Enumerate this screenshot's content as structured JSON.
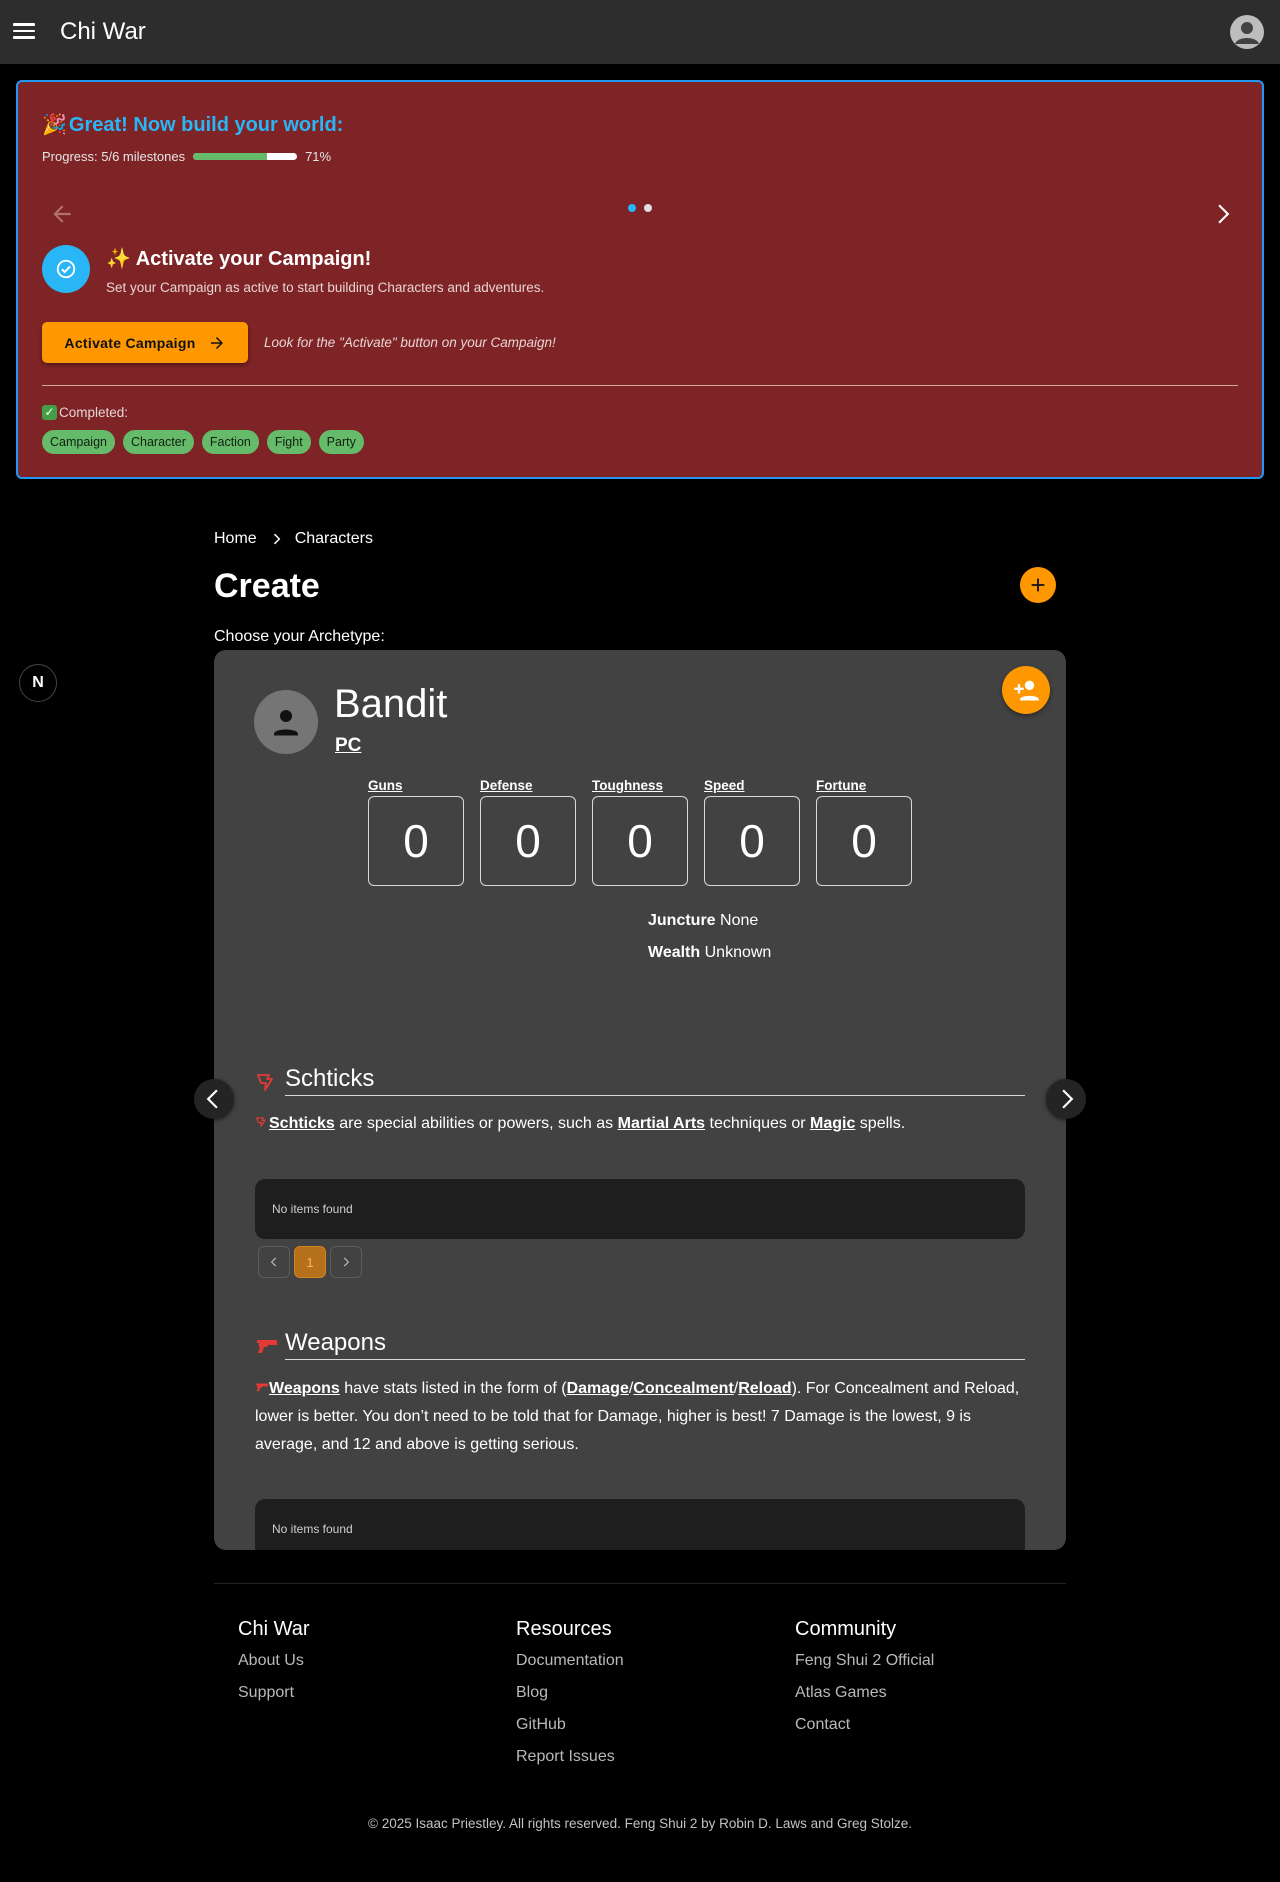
{
  "app": {
    "title": "Chi War"
  },
  "onboarding": {
    "emoji": "🎉",
    "title": "Great! Now build your world:",
    "progress_text": "Progress: 5/6 milestones",
    "progress_percent_text": "71%",
    "progress_value": 0.71,
    "step": {
      "emoji": "✨",
      "title": "Activate your Campaign!",
      "description": "Set your Campaign as active to start building Characters and adventures.",
      "button_label": "Activate Campaign",
      "hint": "Look for the \"Activate\" button on your Campaign!"
    },
    "completed_label": "Completed:",
    "completed_items": [
      "Campaign",
      "Character",
      "Faction",
      "Fight",
      "Party"
    ]
  },
  "breadcrumb": {
    "home": "Home",
    "current": "Characters"
  },
  "page": {
    "title": "Create",
    "subtitle": "Choose your Archetype:"
  },
  "next_logo": "N",
  "character": {
    "name": "Bandit",
    "type": "PC",
    "stats": [
      {
        "label": "Guns",
        "value": "0"
      },
      {
        "label": "Defense",
        "value": "0"
      },
      {
        "label": "Toughness",
        "value": "0"
      },
      {
        "label": "Speed",
        "value": "0"
      },
      {
        "label": "Fortune",
        "value": "0"
      }
    ],
    "juncture_label": "Juncture",
    "juncture_value": "None",
    "wealth_label": "Wealth",
    "wealth_value": "Unknown"
  },
  "schticks": {
    "title": "Schticks",
    "link": "Schticks",
    "text1": " are special abilities or powers, such as ",
    "link2": "Martial Arts",
    "text2": " techniques or ",
    "link3": "Magic",
    "text3": " spells.",
    "empty": "No items found",
    "page": "1"
  },
  "weapons": {
    "title": "Weapons",
    "link": "Weapons",
    "text1": " have stats listed in the form of (",
    "damage": "Damage",
    "concealment": "Concealment",
    "reload": "Reload",
    "text2": "). For Concealment and Reload, lower is better. You don’t need to be told that for Damage, higher is best! 7 Damage is the lowest, 9 is average, and 12 and above is getting serious.",
    "empty": "No items found"
  },
  "footer": {
    "col1": {
      "title": "Chi War",
      "links": [
        "About Us",
        "Support"
      ]
    },
    "col2": {
      "title": "Resources",
      "links": [
        "Documentation",
        "Blog",
        "GitHub",
        "Report Issues"
      ]
    },
    "col3": {
      "title": "Community",
      "links": [
        "Feng Shui 2 Official",
        "Atlas Games",
        "Contact"
      ]
    },
    "copyright": "© 2025 Isaac Priestley. All rights reserved. Feng Shui 2 by Robin D. Laws and Greg Stolze."
  },
  "colors": {
    "appbar": "#2d2d2d",
    "onboarding_bg": "#7f2426",
    "accent_blue": "#29b6f6",
    "accent_orange": "#ff9800",
    "chip_green": "#66bb6a",
    "card_bg": "#424242",
    "icon_red": "#e53935"
  },
  "icons": [
    "menu-icon",
    "account-icon",
    "arrow-left-icon",
    "chevron-right-icon",
    "check-circle-icon",
    "arrow-right-icon",
    "plus-icon",
    "person-icon",
    "person-add-icon",
    "schtick-icon",
    "gun-icon",
    "chevron-left-icon"
  ]
}
